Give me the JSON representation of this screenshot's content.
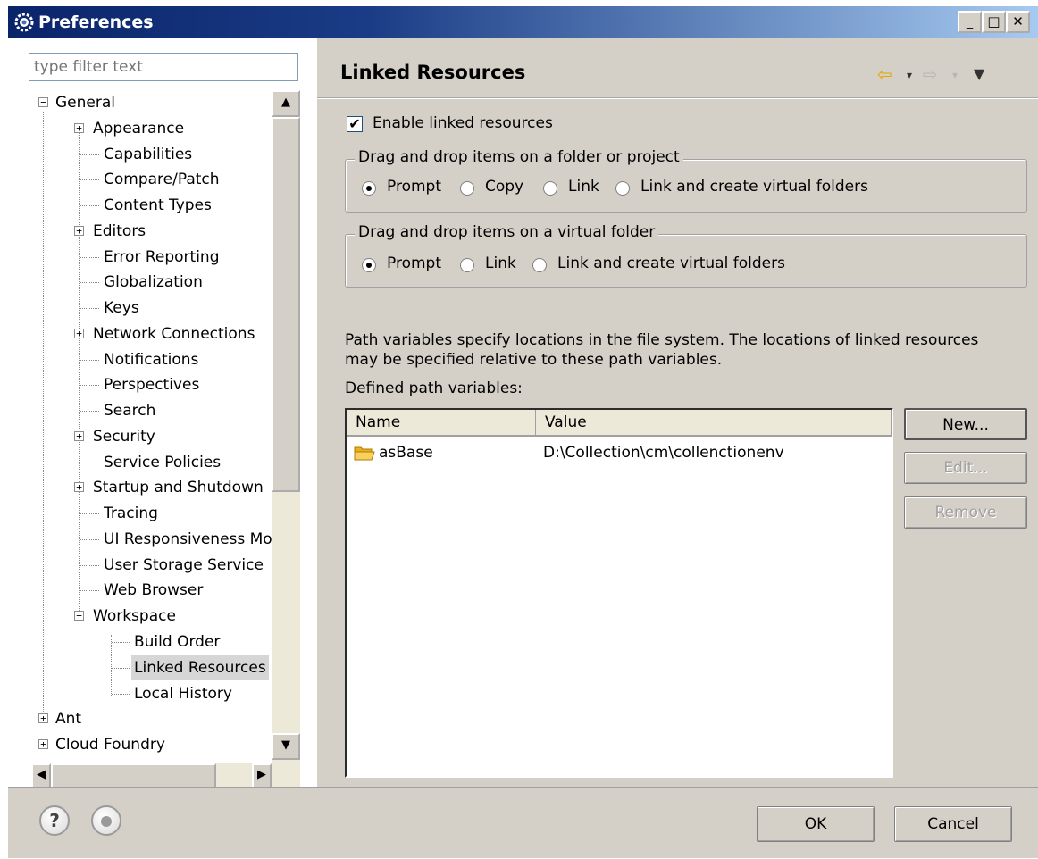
{
  "window": {
    "title": "Preferences"
  },
  "filter": {
    "placeholder": "type filter text"
  },
  "tree": {
    "general": "General",
    "general_children": [
      "Appearance",
      "Capabilities",
      "Compare/Patch",
      "Content Types",
      "Editors",
      "Error Reporting",
      "Globalization",
      "Keys",
      "Network Connections",
      "Notifications",
      "Perspectives",
      "Search",
      "Security",
      "Service Policies",
      "Startup and Shutdown",
      "Tracing",
      "UI Responsiveness Mo",
      "User Storage Service",
      "Web Browser",
      "Workspace"
    ],
    "workspace_children": [
      "Build Order",
      "Linked Resources",
      "Local History"
    ],
    "roots": [
      "Ant",
      "Cloud Foundry"
    ],
    "selected": "Linked Resources"
  },
  "page": {
    "title": "Linked Resources",
    "enable_label": "Enable linked resources",
    "enable_checked": true,
    "group1": {
      "legend": "Drag and drop items on a folder or project",
      "options": [
        "Prompt",
        "Copy",
        "Link",
        "Link and create virtual folders"
      ],
      "selected": "Prompt"
    },
    "group2": {
      "legend": "Drag and drop items on a virtual folder",
      "options": [
        "Prompt",
        "Link",
        "Link and create virtual folders"
      ],
      "selected": "Prompt"
    },
    "description_line1": "Path variables specify locations in the file system. The locations of linked resources",
    "description_line2": "may be specified relative to these path variables.",
    "defined_label": "Defined path variables:",
    "table": {
      "columns": [
        "Name",
        "Value"
      ],
      "rows": [
        {
          "name": "asBase",
          "value": "D:\\Collection\\cm\\collenctionenv"
        }
      ]
    },
    "buttons": {
      "new": "New...",
      "edit": "Edit...",
      "remove": "Remove"
    }
  },
  "footer": {
    "ok": "OK",
    "cancel": "Cancel"
  },
  "colors": {
    "title_bar": "#0a246a",
    "dialog_bg": "#d4d0c8",
    "selection": "#d6d6d6",
    "nav_arrow": "#e0a800"
  }
}
